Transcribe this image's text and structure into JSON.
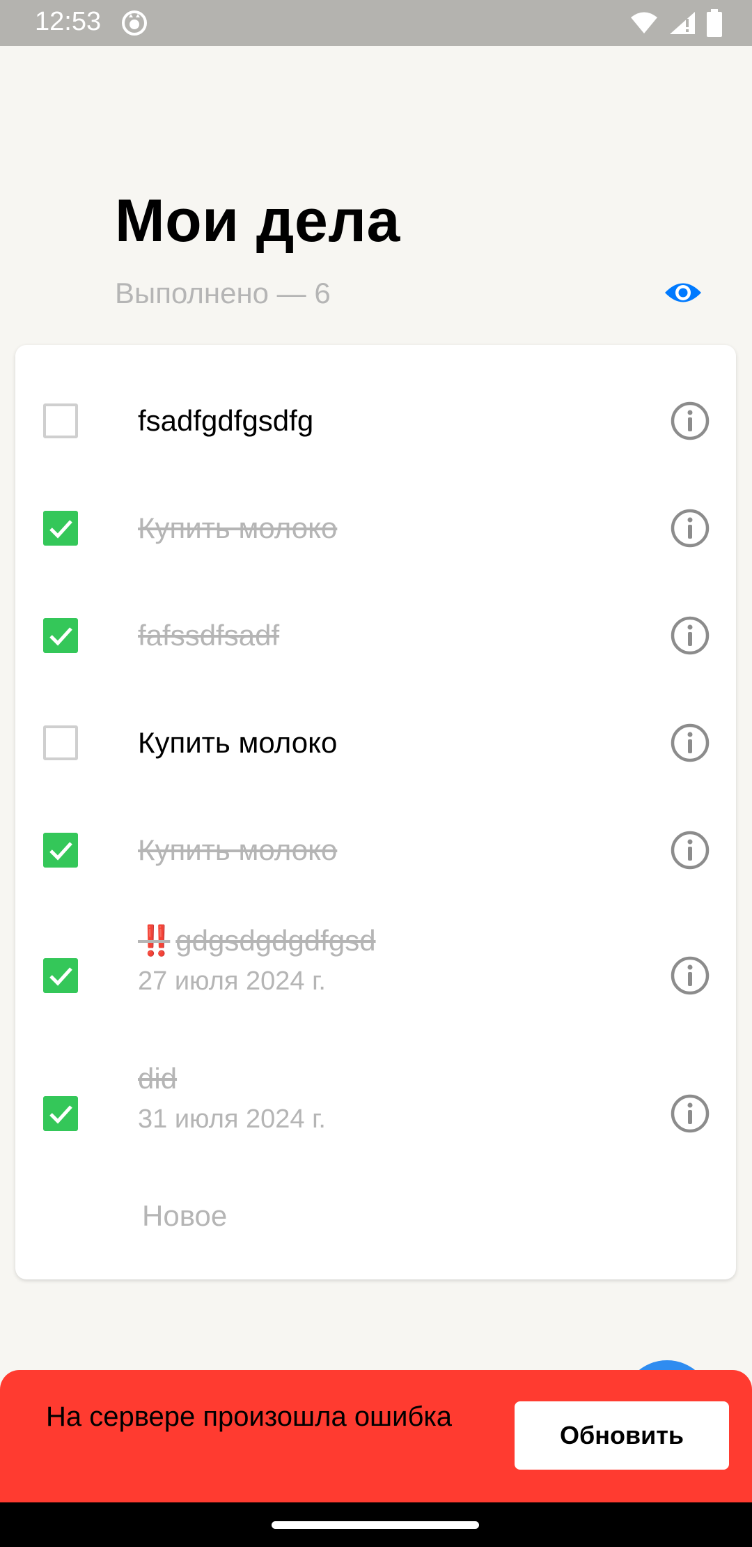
{
  "status_bar": {
    "time": "12:53",
    "icons": [
      "app-notification-icon",
      "wifi-icon",
      "signal-icon",
      "battery-icon"
    ]
  },
  "header": {
    "title": "Мои дела",
    "done_label": "Выполнено — 6",
    "visibility_icon": "eye-icon",
    "accent_color": "#007aff"
  },
  "tasks": [
    {
      "text": "fsadfgdfgsdfg",
      "done": false
    },
    {
      "text": "Купить молоко",
      "done": true
    },
    {
      "text": "fafssdfsadf",
      "done": true
    },
    {
      "text": "Купить молоко",
      "done": false
    },
    {
      "text": "Купить молоко",
      "done": true
    },
    {
      "priority": "‼️",
      "text": "gdgsdgdgdfgsd",
      "date": "27 июля 2024 г.",
      "done": true
    },
    {
      "text": "did",
      "date": "31 июля 2024 г.",
      "done": true
    }
  ],
  "new_task_placeholder": "Новое",
  "snackbar": {
    "message": "На сервере произошла ошибка",
    "action": "Обновить",
    "color": "#ff3b30"
  },
  "colors": {
    "checked": "#34c759",
    "background": "#f7f6f2",
    "muted_text": "#b5b5b5"
  }
}
